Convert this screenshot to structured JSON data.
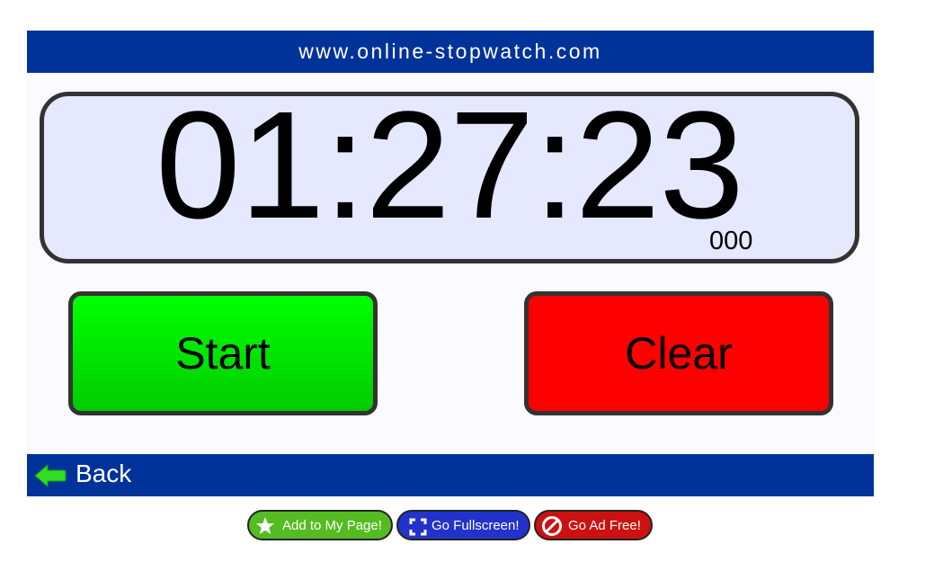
{
  "header": {
    "site": "www.online-stopwatch.com"
  },
  "stopwatch": {
    "time": "01:27:23",
    "milliseconds": "000"
  },
  "controls": {
    "start_label": "Start",
    "clear_label": "Clear"
  },
  "footer": {
    "back_label": "Back"
  },
  "actions": {
    "add_label": "Add to My Page!",
    "fullscreen_label": "Go Fullscreen!",
    "adfree_label": "Go Ad Free!"
  },
  "colors": {
    "bar_blue": "#003399",
    "start_green": "#00ee00",
    "clear_red": "#ff0000",
    "display_bg": "#e6e8ff"
  },
  "icons": [
    "back-arrow-icon",
    "star-icon",
    "fullscreen-icon",
    "no-ads-icon"
  ]
}
